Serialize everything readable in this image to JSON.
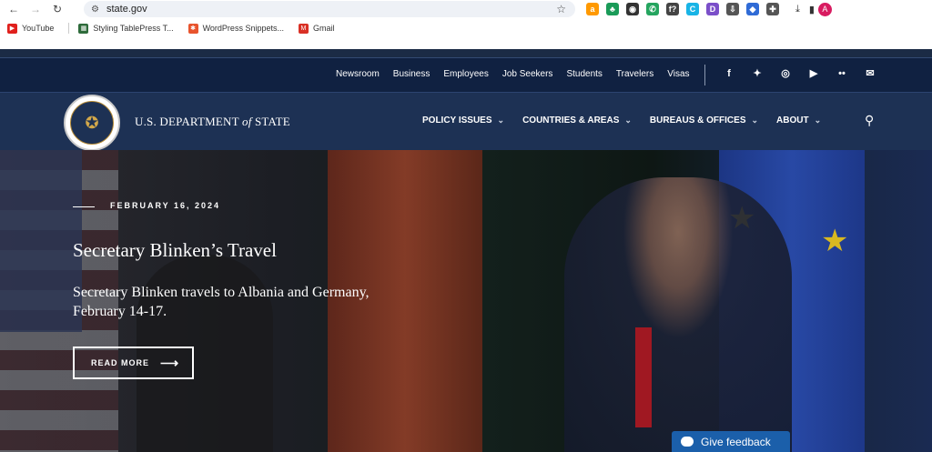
{
  "browser": {
    "url": "state.gov",
    "back_icon": "←",
    "forward_icon": "→",
    "reload_icon": "↻",
    "tune_icon": "⚙",
    "star_icon": "☆",
    "extensions": [
      {
        "name": "amazon-icon",
        "glyph": "a",
        "color": "#ff9900"
      },
      {
        "name": "extension-green-icon",
        "glyph": "♣",
        "color": "#1a9b58"
      },
      {
        "name": "extension-dark-icon",
        "glyph": "◉",
        "color": "#333333"
      },
      {
        "name": "whatsapp-icon",
        "glyph": "✆",
        "color": "#25a55f"
      },
      {
        "name": "function-icon",
        "glyph": "f?",
        "color": "#444444"
      },
      {
        "name": "extension-c-icon",
        "glyph": "C",
        "color": "#19b4e6"
      },
      {
        "name": "extension-d-icon",
        "glyph": "D",
        "color": "#7b4fc9"
      },
      {
        "name": "extension-save-icon",
        "glyph": "⇩",
        "color": "#555555"
      },
      {
        "name": "extension-blue-icon",
        "glyph": "◆",
        "color": "#2f6bd6"
      },
      {
        "name": "puzzle-icon",
        "glyph": "✚",
        "color": "#555555"
      }
    ],
    "download_icon": "⤓",
    "sidepanel_icon": "▮",
    "profile_initial": "A"
  },
  "bookmarks": [
    {
      "label": "YouTube",
      "color": "#e0201c",
      "glyph": "▶"
    },
    {
      "label": "Styling TablePress T...",
      "color": "#2e6b3b",
      "glyph": "▦"
    },
    {
      "label": "WordPress Snippets...",
      "color": "#e8542d",
      "glyph": "✱"
    },
    {
      "label": "Gmail",
      "color": "#d93025",
      "glyph": "M"
    }
  ],
  "utility_links": [
    "Newsroom",
    "Business",
    "Employees",
    "Job Seekers",
    "Students",
    "Travelers",
    "Visas"
  ],
  "social": [
    {
      "name": "facebook-icon",
      "glyph": "f"
    },
    {
      "name": "twitter-icon",
      "glyph": "✦"
    },
    {
      "name": "instagram-icon",
      "glyph": "◎"
    },
    {
      "name": "youtube-icon",
      "glyph": "▶"
    },
    {
      "name": "flickr-icon",
      "glyph": "••"
    },
    {
      "name": "email-icon",
      "glyph": "✉"
    }
  ],
  "site": {
    "name_prefix": "U.S. DEPARTMENT ",
    "name_of": "of",
    "name_suffix": " STATE",
    "seal_glyph": "✪"
  },
  "menu": [
    {
      "label": "POLICY ISSUES"
    },
    {
      "label": "COUNTRIES & AREAS"
    },
    {
      "label": "BUREAUS & OFFICES"
    },
    {
      "label": "ABOUT"
    }
  ],
  "menu_chevron": "⌄",
  "search_icon": "⚲",
  "hero": {
    "date": "FEBRUARY 16, 2024",
    "title": "Secretary Blinken’s Travel",
    "description": "Secretary Blinken travels to Albania and Germany, February 14-17.",
    "button_label": "READ MORE",
    "button_arrow": "⟶"
  },
  "feedback": {
    "label": "Give feedback"
  }
}
